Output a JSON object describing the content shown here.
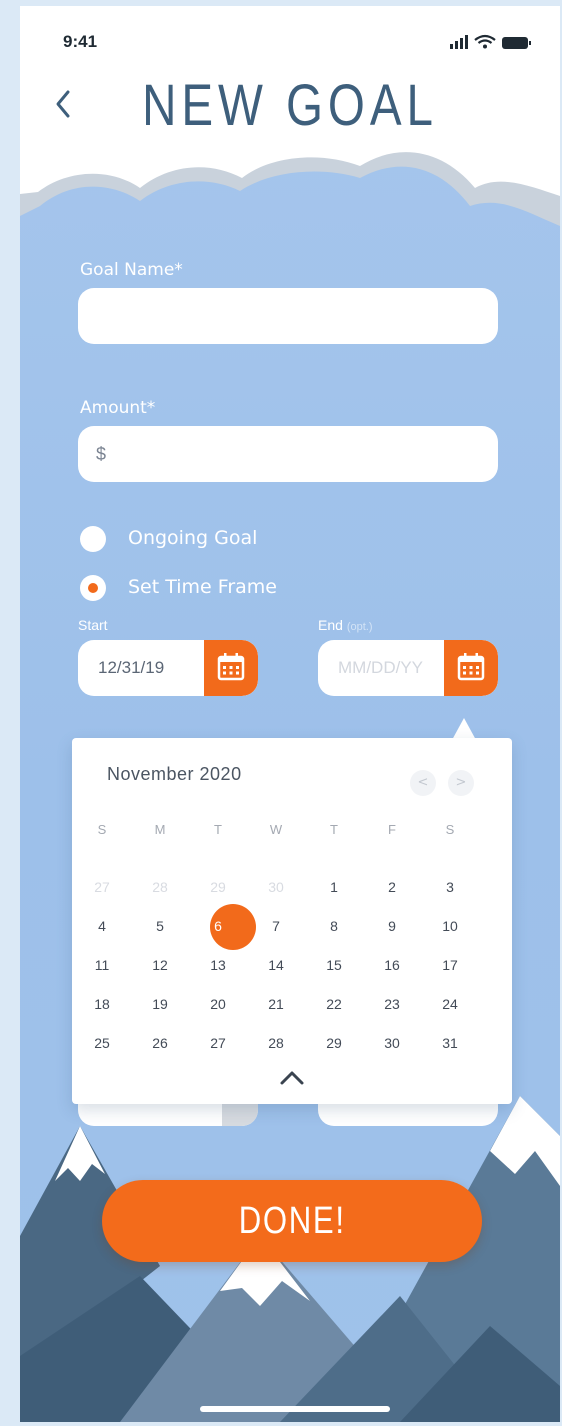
{
  "status_bar": {
    "time": "9:41"
  },
  "header": {
    "title": "NEW GOAL"
  },
  "form": {
    "goal_name": {
      "label": "Goal Name*",
      "value": ""
    },
    "amount": {
      "label": "Amount*",
      "value": "$"
    },
    "options": [
      {
        "label": "Ongoing Goal",
        "selected": false
      },
      {
        "label": "Set Time Frame",
        "selected": true
      }
    ],
    "start": {
      "label": "Start",
      "value": "12/31/19"
    },
    "end": {
      "label": "End",
      "label_suffix": "(opt.)",
      "placeholder": "MM/DD/YY"
    }
  },
  "calendar": {
    "month_label": "November  2020",
    "prev": "<",
    "next": ">",
    "weekdays": [
      "S",
      "M",
      "T",
      "W",
      "T",
      "F",
      "S"
    ],
    "weeks": [
      [
        "27",
        "28",
        "29",
        "30",
        "1",
        "2",
        "3"
      ],
      [
        "4",
        "5",
        "6",
        "7",
        "8",
        "9",
        "10"
      ],
      [
        "11",
        "12",
        "13",
        "14",
        "15",
        "16",
        "17"
      ],
      [
        "18",
        "19",
        "20",
        "21",
        "22",
        "23",
        "24"
      ],
      [
        "25",
        "26",
        "27",
        "28",
        "29",
        "30",
        "31"
      ]
    ],
    "muted_first_row_count": 4,
    "selected_day": "6"
  },
  "done_button": {
    "label": "DONE!"
  },
  "colors": {
    "accent": "#f26a1b",
    "title": "#3e5f7c",
    "sky": "#9dc0ea",
    "mountain_dark": "#3f5d78",
    "snow": "#ffffff"
  },
  "icons": [
    "back-chevron-icon",
    "signal-icon",
    "wifi-icon",
    "battery-icon",
    "calendar-icon",
    "chevron-up-icon"
  ]
}
